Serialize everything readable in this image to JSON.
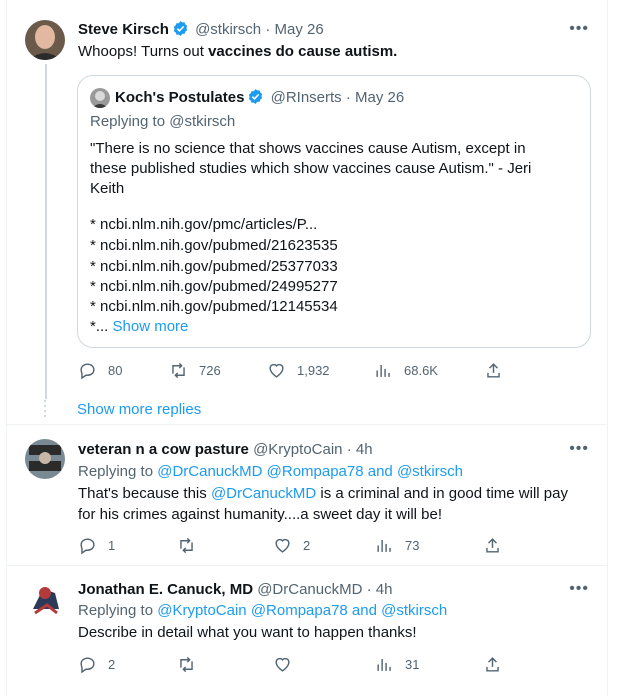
{
  "main_tweet": {
    "display_name": "Steve Kirsch",
    "handle": "@stkirsch",
    "date": "· May 26",
    "text_plain": "Whoops! Turns out ",
    "text_bold": "vaccines do cause autism.",
    "quote": {
      "display_name": "Koch's Postulates",
      "handle": "@RInserts",
      "date": "· May 26",
      "replying_to": "Replying to @stkirsch",
      "lines": [
        "\"There is no science that shows vaccines cause Autism, except in",
        "these published studies which show vaccines cause Autism.\" - Jeri",
        "Keith",
        "* ncbi.nlm.nih.gov/pmc/articles/P...",
        "* ncbi.nlm.nih.gov/pubmed/21623535",
        "* ncbi.nlm.nih.gov/pubmed/25377033",
        "* ncbi.nlm.nih.gov/pubmed/24995277",
        "* ncbi.nlm.nih.gov/pubmed/12145534"
      ],
      "last_prefix": "*...",
      "show_more": "Show more"
    },
    "actions": {
      "replies": "80",
      "retweets": "726",
      "likes": "1,932",
      "views": "68.6K"
    }
  },
  "show_more_replies": "Show more replies",
  "reply1": {
    "display_name": "veteran n a cow pasture",
    "handle": "@KryptoCain",
    "date": "· 4h",
    "replying_prefix": "Replying to ",
    "replying_users": "@DrCanuckMD @Rompapa78 and @stkirsch",
    "text_1a": "That's because this ",
    "mention": "@DrCanuckMD",
    "text_1b": " is a criminal and in good time will pay",
    "text_2": "for his crimes against humanity....a sweet day it will be!",
    "actions": {
      "replies": "1",
      "retweets": "",
      "likes": "2",
      "views": "73"
    }
  },
  "reply2": {
    "display_name": "Jonathan E. Canuck, MD",
    "handle": "@DrCanuckMD",
    "date": "· 4h",
    "replying_prefix": "Replying to ",
    "replying_users": "@KryptoCain @Rompapa78 and @stkirsch",
    "text": "Describe in detail what you want to happen thanks!",
    "actions": {
      "replies": "2",
      "retweets": "",
      "likes": "",
      "views": "31"
    }
  },
  "colors": {
    "accent": "#1d9bf0",
    "text": "#0f1419",
    "secondary": "#536471"
  }
}
